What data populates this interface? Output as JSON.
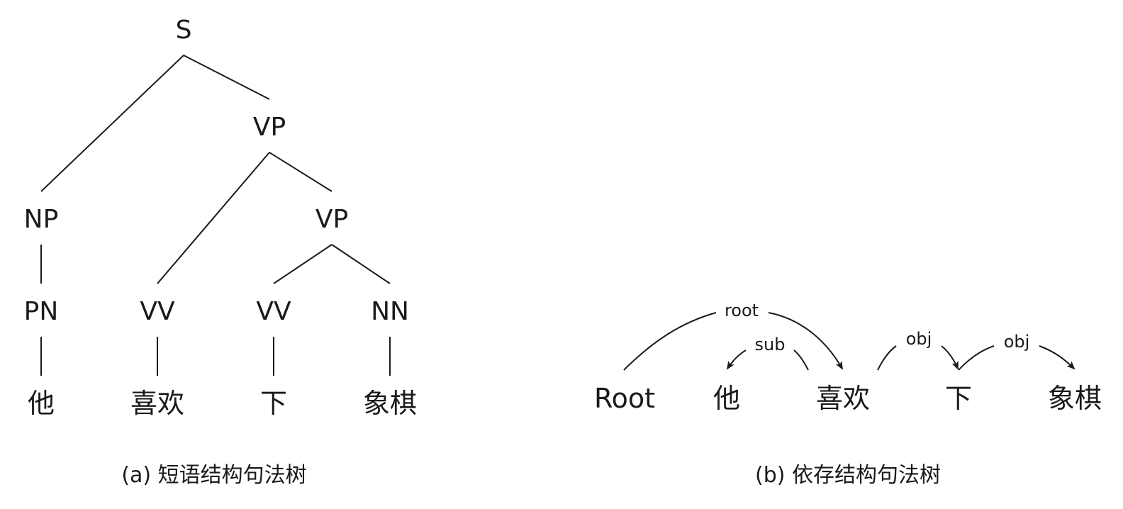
{
  "phrase_tree": {
    "nodes": {
      "s": "S",
      "vp_top": "VP",
      "np": "NP",
      "vp_inner": "VP",
      "pn": "PN",
      "vv1": "VV",
      "vv2": "VV",
      "nn": "NN"
    },
    "words": {
      "ta": "他",
      "xihuan": "喜欢",
      "xia": "下",
      "xiangqi": "象棋"
    },
    "caption": "(a) 短语结构句法树"
  },
  "dependency_tree": {
    "tokens": {
      "root": "Root",
      "ta": "他",
      "xihuan": "喜欢",
      "xia": "下",
      "xiangqi": "象棋"
    },
    "relations": {
      "root": "root",
      "sub": "sub",
      "obj1": "obj",
      "obj2": "obj"
    },
    "caption": "(b) 依存结构句法树"
  }
}
